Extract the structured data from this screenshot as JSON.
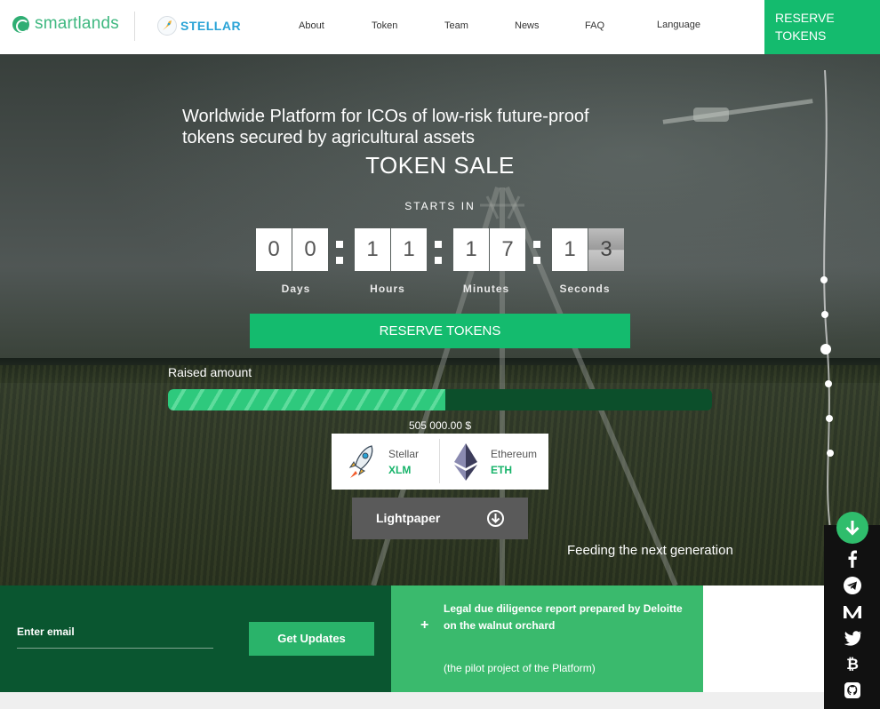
{
  "header": {
    "brand": "smartlands",
    "partner": "STELLAR",
    "nav": [
      "About",
      "Token",
      "Team",
      "News",
      "FAQ",
      "Language"
    ],
    "reserve_line1": "RESERVE",
    "reserve_line2": "TOKENS"
  },
  "hero": {
    "headline_line1": "Worldwide Platform for ICOs of low-risk future-proof",
    "headline_line2": "tokens secured by agricultural assets",
    "title": "TOKEN SALE",
    "starts_in": "STARTS IN",
    "countdown": {
      "days": [
        "0",
        "0"
      ],
      "hours": [
        "1",
        "1"
      ],
      "minutes": [
        "1",
        "7"
      ],
      "seconds": [
        "1",
        "3"
      ]
    },
    "units": [
      "Days",
      "Hours",
      "Minutes",
      "Seconds"
    ],
    "reserve_button": "RESERVE TOKENS",
    "raised_label": "Raised amount",
    "raised_progress": 0.51,
    "raised_value": "505 000.00 $",
    "currencies": [
      {
        "name": "Stellar",
        "code": "XLM"
      },
      {
        "name": "Ethereum",
        "code": "ETH"
      }
    ],
    "lightpaper": "Lightpaper",
    "tagline": "Feeding the next generation"
  },
  "bottom": {
    "email_placeholder": "Enter email",
    "get_updates": "Get Updates",
    "legal_title": "Legal due diligence report prepared by Deloitte on the walnut orchard",
    "legal_sub": "(the pilot project of the Platform)"
  },
  "social": [
    "facebook",
    "telegram",
    "medium",
    "twitter",
    "bitcoin",
    "github"
  ],
  "colors": {
    "accent": "#14bb6e",
    "dark_green": "#0a5630",
    "mid_green": "#3aba6d",
    "stellar_blue": "#29a3d6"
  }
}
